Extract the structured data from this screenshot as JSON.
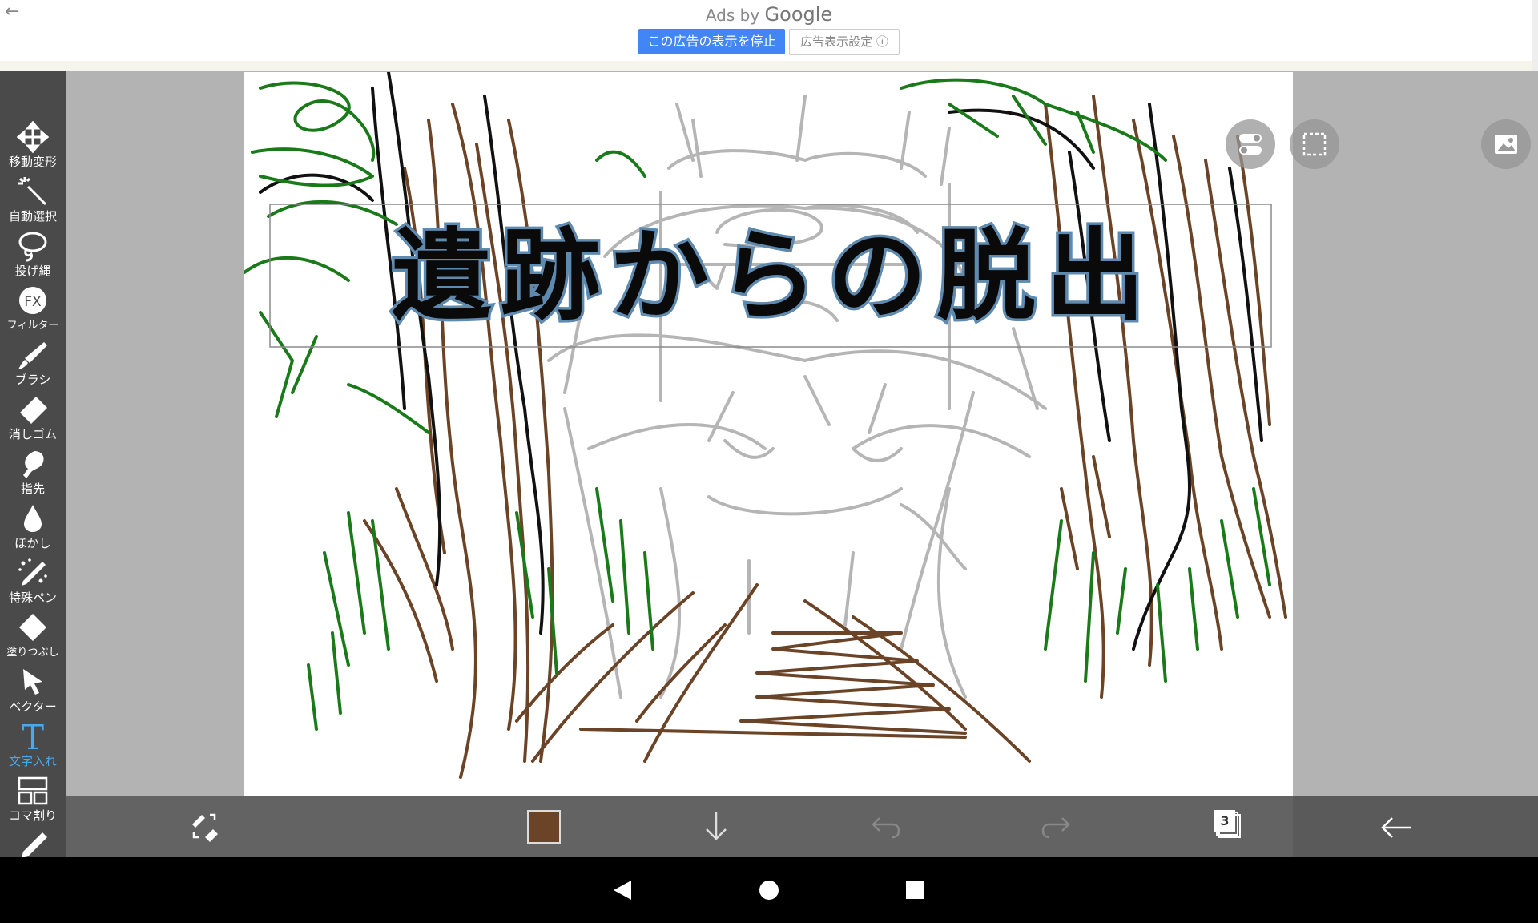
{
  "ad": {
    "ads_by": "Ads by",
    "brand": "Google",
    "stop_button": "この広告の表示を停止",
    "settings_button": "広告表示設定 ⓘ"
  },
  "canvas_title": "遺跡からの脱出",
  "tools": [
    {
      "label": "移動変形",
      "icon": "move-transform-icon"
    },
    {
      "label": "自動選択",
      "icon": "magic-wand-icon"
    },
    {
      "label": "投げ縄",
      "icon": "lasso-icon"
    },
    {
      "label": "フィルター",
      "icon": "fx-filter-icon"
    },
    {
      "label": "ブラシ",
      "icon": "brush-icon"
    },
    {
      "label": "消しゴム",
      "icon": "eraser-icon"
    },
    {
      "label": "指先",
      "icon": "finger-smudge-icon"
    },
    {
      "label": "ぼかし",
      "icon": "blur-drop-icon"
    },
    {
      "label": "特殊ペン",
      "icon": "special-pen-icon"
    },
    {
      "label": "塗りつぶし",
      "icon": "fill-bucket-icon"
    },
    {
      "label": "ベクター",
      "icon": "vector-cursor-icon"
    },
    {
      "label": "文字入れ",
      "icon": "text-tool-icon",
      "active": true
    },
    {
      "label": "コマ割り",
      "icon": "panel-layout-icon"
    },
    {
      "label": "",
      "icon": "eyedropper-icon"
    }
  ],
  "bottom": {
    "layer_count": "3",
    "current_color": "#6b4326"
  },
  "colors": {
    "accent": "#4285f4",
    "active_tool": "#4aa8f0",
    "toolbar_bg": "#4a4a4a",
    "workspace_bg": "#b3b3b3"
  }
}
